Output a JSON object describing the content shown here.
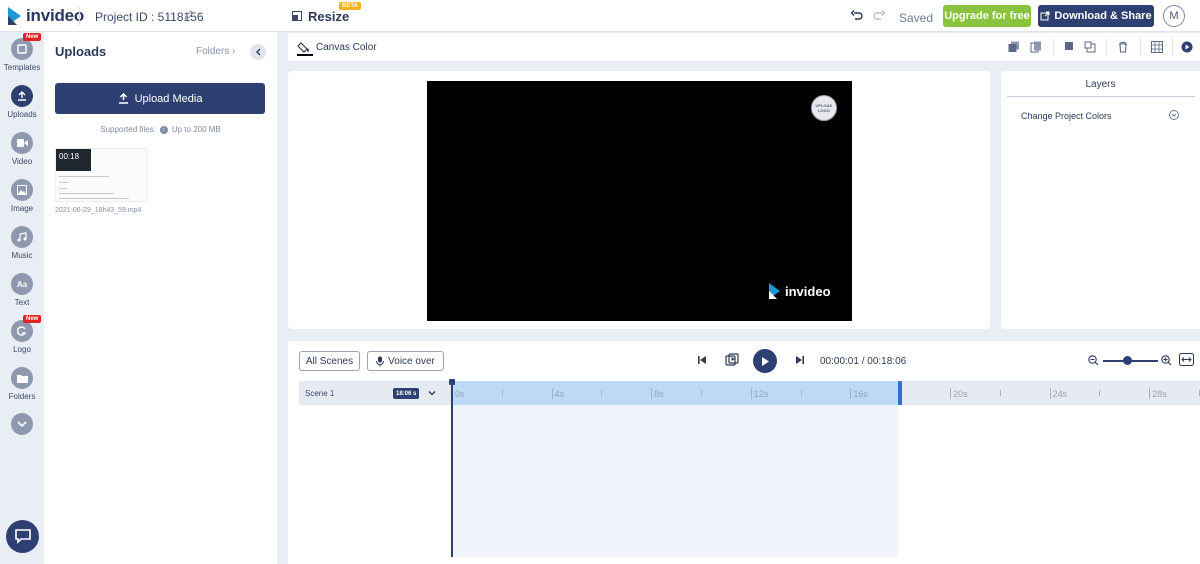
{
  "app": {
    "logo_text": "invideo",
    "project_id": "Project ID : 5118156",
    "resize_label": "Resize",
    "beta_badge": "BETA",
    "status": "Saved",
    "upgrade_label": "Upgrade for free",
    "download_label": "Download & Share",
    "avatar_initial": "M"
  },
  "sidebar": {
    "items": [
      {
        "label": "Templates",
        "icon": "templates-icon",
        "badge": "New"
      },
      {
        "label": "Uploads",
        "icon": "upload-icon"
      },
      {
        "label": "Video",
        "icon": "video-icon"
      },
      {
        "label": "Image",
        "icon": "image-icon"
      },
      {
        "label": "Music",
        "icon": "music-icon"
      },
      {
        "label": "Text",
        "icon": "text-icon",
        "glyph": "Aa"
      },
      {
        "label": "Logo",
        "icon": "logo-icon",
        "badge": "New"
      },
      {
        "label": "Folders",
        "icon": "folder-icon"
      }
    ]
  },
  "uploads": {
    "title": "Uploads",
    "folders_link": "Folders",
    "upload_button": "Upload Media",
    "supported_label": "Supported files:",
    "supported_value": "Up to 200 MB",
    "media": [
      {
        "duration": "00:18",
        "filename": "2021-06-29_18h43_59.mp4"
      }
    ]
  },
  "canvas": {
    "toolbar_label": "Canvas Color",
    "upload_logo_line1": "UPLOAD",
    "upload_logo_line2": "LOGO",
    "watermark_text": "invideo"
  },
  "layers": {
    "title": "Layers",
    "row_label": "Change Project Colors"
  },
  "timeline": {
    "all_scenes_label": "All Scenes",
    "voice_over_label": "Voice over",
    "current_time": "00:00:01",
    "separator": "/",
    "total_time": "00:18:06",
    "zoom_level": 0.45,
    "scene_label": "Scene 1",
    "scene_duration": "18:06 s",
    "ticks": [
      "0s",
      "4s",
      "8s",
      "12s",
      "16s",
      "20s",
      "24s",
      "28s"
    ]
  },
  "colors": {
    "primary": "#2e3f72",
    "upgrade": "#8ac43f",
    "new_badge": "#e02424",
    "beta_badge": "#f2b21b",
    "selection": "#bcd9f5"
  }
}
